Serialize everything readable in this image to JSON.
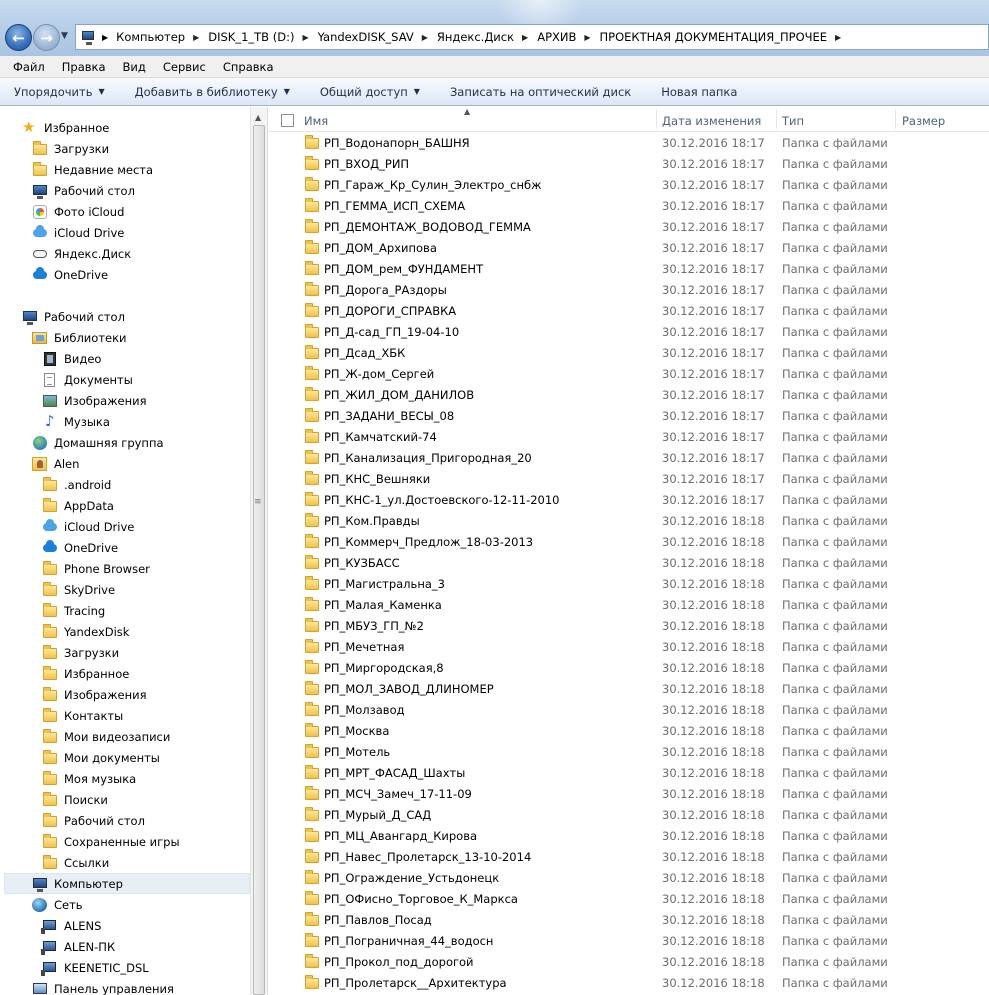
{
  "address": {
    "crumbs": [
      "Компьютер",
      "DISK_1_TB (D:)",
      "YandexDISK_SAV",
      "Яндекс.Диск",
      "АРХИВ",
      "ПРОЕКТНАЯ ДОКУМЕНТАЦИЯ_ПРОЧЕЕ"
    ]
  },
  "menu": [
    "Файл",
    "Правка",
    "Вид",
    "Сервис",
    "Справка"
  ],
  "toolbar": {
    "organize": "Упорядочить",
    "add_library": "Добавить в библиотеку",
    "share": "Общий доступ",
    "burn": "Записать на оптический диск",
    "new_folder": "Новая папка"
  },
  "nav": [
    {
      "label": "Избранное",
      "icon": "star-icon",
      "indent": 0
    },
    {
      "label": "Загрузки",
      "icon": "downloads-folder-icon",
      "indent": 1
    },
    {
      "label": "Недавние места",
      "icon": "recent-places-icon",
      "indent": 1
    },
    {
      "label": "Рабочий стол",
      "icon": "desktop-icon",
      "indent": 1
    },
    {
      "label": "Фото iCloud",
      "icon": "icloud-photos-icon",
      "indent": 1
    },
    {
      "label": "iCloud Drive",
      "icon": "icloud-drive-icon",
      "indent": 1
    },
    {
      "label": "Яндекс.Диск",
      "icon": "yandex-disk-icon",
      "indent": 1
    },
    {
      "label": "OneDrive",
      "icon": "onedrive-icon",
      "indent": 1
    },
    {
      "label": "",
      "icon": "",
      "indent": 0
    },
    {
      "label": "Рабочий стол",
      "icon": "desktop-icon",
      "indent": 0
    },
    {
      "label": "Библиотеки",
      "icon": "libraries-icon",
      "indent": 1
    },
    {
      "label": "Видео",
      "icon": "video-icon",
      "indent": 2
    },
    {
      "label": "Документы",
      "icon": "documents-icon",
      "indent": 2
    },
    {
      "label": "Изображения",
      "icon": "pictures-icon",
      "indent": 2
    },
    {
      "label": "Музыка",
      "icon": "music-icon",
      "indent": 2
    },
    {
      "label": "Домашняя группа",
      "icon": "homegroup-icon",
      "indent": 1
    },
    {
      "label": "Alen",
      "icon": "user-folder-icon",
      "indent": 1
    },
    {
      "label": ".android",
      "icon": "folder-icon",
      "indent": 2
    },
    {
      "label": "AppData",
      "icon": "folder-icon",
      "indent": 2
    },
    {
      "label": "iCloud Drive",
      "icon": "icloud-drive-icon",
      "indent": 2
    },
    {
      "label": "OneDrive",
      "icon": "onedrive-icon",
      "indent": 2
    },
    {
      "label": "Phone Browser",
      "icon": "folder-icon",
      "indent": 2
    },
    {
      "label": "SkyDrive",
      "icon": "folder-icon",
      "indent": 2
    },
    {
      "label": "Tracing",
      "icon": "folder-icon",
      "indent": 2
    },
    {
      "label": "YandexDisk",
      "icon": "folder-icon",
      "indent": 2
    },
    {
      "label": "Загрузки",
      "icon": "downloads-folder-icon",
      "indent": 2
    },
    {
      "label": "Избранное",
      "icon": "favorites-folder-icon",
      "indent": 2
    },
    {
      "label": "Изображения",
      "icon": "pictures-folder-icon",
      "indent": 2
    },
    {
      "label": "Контакты",
      "icon": "contacts-folder-icon",
      "indent": 2
    },
    {
      "label": "Мои видеозаписи",
      "icon": "videos-folder-icon",
      "indent": 2
    },
    {
      "label": "Мои документы",
      "icon": "documents-folder-icon",
      "indent": 2
    },
    {
      "label": "Моя музыка",
      "icon": "music-folder-icon",
      "indent": 2
    },
    {
      "label": "Поиски",
      "icon": "searches-folder-icon",
      "indent": 2
    },
    {
      "label": "Рабочий стол",
      "icon": "desktop-folder-icon",
      "indent": 2
    },
    {
      "label": "Сохраненные игры",
      "icon": "saved-games-folder-icon",
      "indent": 2
    },
    {
      "label": "Ссылки",
      "icon": "links-folder-icon",
      "indent": 2
    },
    {
      "label": "Компьютер",
      "icon": "computer-icon",
      "indent": 1,
      "selected": true
    },
    {
      "label": "Сеть",
      "icon": "network-icon",
      "indent": 1
    },
    {
      "label": "ALENS",
      "icon": "network-computer-icon",
      "indent": 2
    },
    {
      "label": "ALEN-ПК",
      "icon": "network-computer-icon",
      "indent": 2
    },
    {
      "label": "KEENETIC_DSL",
      "icon": "network-computer-icon",
      "indent": 2
    },
    {
      "label": "Панель управления",
      "icon": "control-panel-icon",
      "indent": 1
    }
  ],
  "columns": {
    "name": "Имя",
    "date": "Дата изменения",
    "type": "Тип",
    "size": "Размер"
  },
  "files": [
    {
      "name": "РП_Водонапорн_БАШНЯ",
      "date": "30.12.2016 18:17",
      "type": "Папка с файлами"
    },
    {
      "name": "РП_ВХОД_РИП",
      "date": "30.12.2016 18:17",
      "type": "Папка с файлами"
    },
    {
      "name": "РП_Гараж_Кр_Сулин_Электро_снбж",
      "date": "30.12.2016 18:17",
      "type": "Папка с файлами"
    },
    {
      "name": "РП_ГЕММА_ИСП_СХЕМА",
      "date": "30.12.2016 18:17",
      "type": "Папка с файлами"
    },
    {
      "name": "РП_ДЕМОНТАЖ_ВОДОВОД_ГЕММА",
      "date": "30.12.2016 18:17",
      "type": "Папка с файлами"
    },
    {
      "name": "РП_ДОМ_Архипова",
      "date": "30.12.2016 18:17",
      "type": "Папка с файлами"
    },
    {
      "name": "РП_ДОМ_рем_ФУНДАМЕНТ",
      "date": "30.12.2016 18:17",
      "type": "Папка с файлами"
    },
    {
      "name": "РП_Дорога_РАздоры",
      "date": "30.12.2016 18:17",
      "type": "Папка с файлами"
    },
    {
      "name": "РП_ДОРОГИ_СПРАВКА",
      "date": "30.12.2016 18:17",
      "type": "Папка с файлами"
    },
    {
      "name": "РП_Д-сад_ГП_19-04-10",
      "date": "30.12.2016 18:17",
      "type": "Папка с файлами"
    },
    {
      "name": "РП_Дсад_ХБК",
      "date": "30.12.2016 18:17",
      "type": "Папка с файлами"
    },
    {
      "name": "РП_Ж-дом_Сергей",
      "date": "30.12.2016 18:17",
      "type": "Папка с файлами"
    },
    {
      "name": "РП_ЖИЛ_ДОМ_ДАНИЛОВ",
      "date": "30.12.2016 18:17",
      "type": "Папка с файлами"
    },
    {
      "name": "РП_ЗАДАНИ_ВЕСЫ_08",
      "date": "30.12.2016 18:17",
      "type": "Папка с файлами"
    },
    {
      "name": "РП_Камчатский-74",
      "date": "30.12.2016 18:17",
      "type": "Папка с файлами"
    },
    {
      "name": "РП_Канализация_Пригородная_20",
      "date": "30.12.2016 18:17",
      "type": "Папка с файлами"
    },
    {
      "name": "РП_КНС_Вешняки",
      "date": "30.12.2016 18:17",
      "type": "Папка с файлами"
    },
    {
      "name": "РП_КНС-1_ул.Достоевского-12-11-2010",
      "date": "30.12.2016 18:17",
      "type": "Папка с файлами"
    },
    {
      "name": "РП_Ком.Правды",
      "date": "30.12.2016 18:18",
      "type": "Папка с файлами"
    },
    {
      "name": "РП_Коммерч_Предлож_18-03-2013",
      "date": "30.12.2016 18:18",
      "type": "Папка с файлами"
    },
    {
      "name": "РП_КУЗБАСС",
      "date": "30.12.2016 18:18",
      "type": "Папка с файлами"
    },
    {
      "name": "РП_Магистральна_3",
      "date": "30.12.2016 18:18",
      "type": "Папка с файлами"
    },
    {
      "name": "РП_Малая_Каменка",
      "date": "30.12.2016 18:18",
      "type": "Папка с файлами"
    },
    {
      "name": "РП_МБУЗ_ГП_№2",
      "date": "30.12.2016 18:18",
      "type": "Папка с файлами"
    },
    {
      "name": "РП_Мечетная",
      "date": "30.12.2016 18:18",
      "type": "Папка с файлами"
    },
    {
      "name": "РП_Миргородская,8",
      "date": "30.12.2016 18:18",
      "type": "Папка с файлами"
    },
    {
      "name": "РП_МОЛ_ЗАВОД_ДЛИНОМЕР",
      "date": "30.12.2016 18:18",
      "type": "Папка с файлами"
    },
    {
      "name": "РП_Молзавод",
      "date": "30.12.2016 18:18",
      "type": "Папка с файлами"
    },
    {
      "name": "РП_Москва",
      "date": "30.12.2016 18:18",
      "type": "Папка с файлами"
    },
    {
      "name": "РП_Мотель",
      "date": "30.12.2016 18:18",
      "type": "Папка с файлами"
    },
    {
      "name": "РП_МРТ_ФАСАД_Шахты",
      "date": "30.12.2016 18:18",
      "type": "Папка с файлами"
    },
    {
      "name": "РП_МСЧ_Замеч_17-11-09",
      "date": "30.12.2016 18:18",
      "type": "Папка с файлами"
    },
    {
      "name": "РП_Мурый_Д_САД",
      "date": "30.12.2016 18:18",
      "type": "Папка с файлами"
    },
    {
      "name": "РП_МЦ_Авангард_Кирова",
      "date": "30.12.2016 18:18",
      "type": "Папка с файлами"
    },
    {
      "name": "РП_Навес_Пролетарск_13-10-2014",
      "date": "30.12.2016 18:18",
      "type": "Папка с файлами"
    },
    {
      "name": "РП_Ограждение_Устьдонецк",
      "date": "30.12.2016 18:18",
      "type": "Папка с файлами"
    },
    {
      "name": "РП_ОФисно_Торговое_К_Маркса",
      "date": "30.12.2016 18:18",
      "type": "Папка с файлами"
    },
    {
      "name": "РП_Павлов_Посад",
      "date": "30.12.2016 18:18",
      "type": "Папка с файлами"
    },
    {
      "name": "РП_Пограничная_44_водосн",
      "date": "30.12.2016 18:18",
      "type": "Папка с файлами"
    },
    {
      "name": "РП_Прокол_под_дорогой",
      "date": "30.12.2016 18:18",
      "type": "Папка с файлами"
    },
    {
      "name": "РП_Пролетарск__Архитектура",
      "date": "30.12.2016 18:18",
      "type": "Папка с файлами"
    }
  ]
}
